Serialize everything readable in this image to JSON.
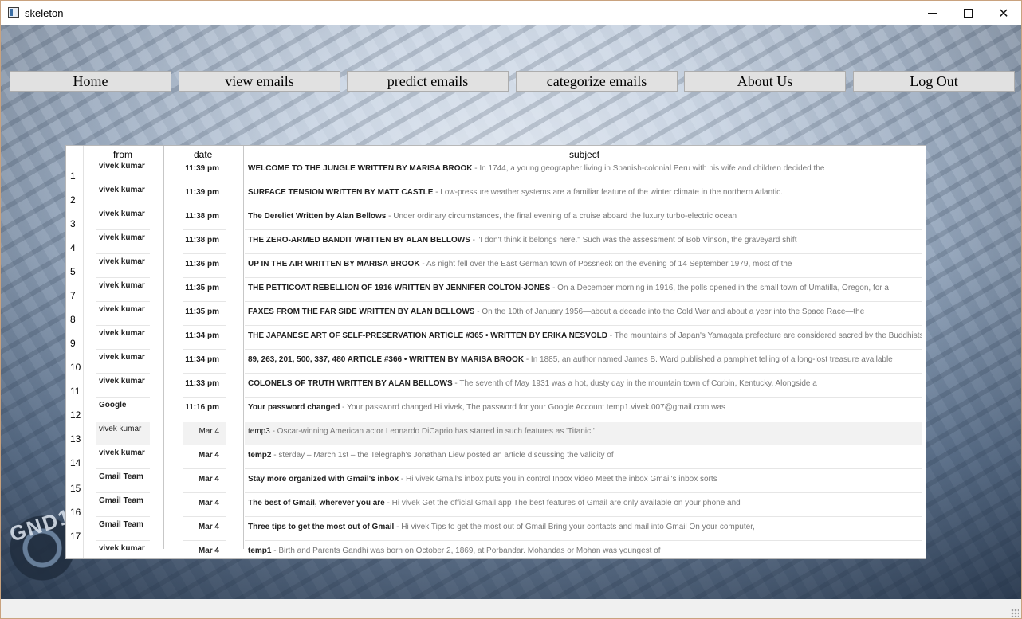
{
  "window": {
    "title": "skeleton"
  },
  "nav": [
    {
      "label": "Home"
    },
    {
      "label": "view emails"
    },
    {
      "label": "predict emails"
    },
    {
      "label": "categorize emails"
    },
    {
      "label": "About Us"
    },
    {
      "label": "Log Out"
    }
  ],
  "table": {
    "headers": {
      "from": "from",
      "date": "date",
      "subject": "subject"
    },
    "row_numbers": [
      "1",
      "2",
      "3",
      "4",
      "5",
      "7",
      "8",
      "9",
      "10",
      "11",
      "12",
      "13",
      "14",
      "15",
      "16",
      "17"
    ],
    "rows": [
      {
        "from": "vivek kumar",
        "date": "11:39 pm",
        "subject": "WELCOME TO THE JUNGLE WRITTEN BY MARISA BROOK",
        "snippet": " - In 1744, a young geographer living in Spanish-colonial Peru with his wife and children decided the",
        "read": false
      },
      {
        "from": "vivek kumar",
        "date": "11:39 pm",
        "subject": "SURFACE TENSION WRITTEN BY MATT CASTLE",
        "snippet": " - Low-pressure weather systems are a familiar feature of the winter climate in the northern Atlantic.",
        "read": false
      },
      {
        "from": "vivek kumar",
        "date": "11:38 pm",
        "subject": "The Derelict Written by Alan Bellows",
        "snippet": " - Under ordinary circumstances, the final evening of a cruise aboard the luxury turbo-electric ocean",
        "read": false
      },
      {
        "from": "vivek kumar",
        "date": "11:38 pm",
        "subject": "THE ZERO-ARMED BANDIT WRITTEN BY ALAN BELLOWS",
        "snippet": " - \"I don't think it belongs here.\" Such was the assessment of Bob Vinson, the graveyard shift",
        "read": false
      },
      {
        "from": "vivek kumar",
        "date": "11:36 pm",
        "subject": "UP IN THE AIR WRITTEN BY MARISA BROOK",
        "snippet": " - As night fell over the East German town of Pössneck on the evening of 14 September 1979, most of the",
        "read": false
      },
      {
        "from": "vivek kumar",
        "date": "11:35 pm",
        "subject": "THE PETTICOAT REBELLION OF 1916 WRITTEN BY JENNIFER COLTON-JONES",
        "snippet": " - On a December morning in 1916, the polls opened in the small town of Umatilla, Oregon, for a",
        "read": false
      },
      {
        "from": "vivek kumar",
        "date": "11:35 pm",
        "subject": "FAXES FROM THE FAR SIDE WRITTEN BY ALAN BELLOWS",
        "snippet": " - On the 10th of January 1956—about a decade into the Cold War and about a year into the Space Race—the",
        "read": false
      },
      {
        "from": "vivek kumar",
        "date": "11:34 pm",
        "subject": "THE JAPANESE ART OF SELF-PRESERVATION ARTICLE #365 • WRITTEN BY ERIKA NESVOLD",
        "snippet": " - The mountains of Japan's Yamagata prefecture are considered sacred by the Buddhists in the reg",
        "read": false
      },
      {
        "from": "vivek kumar",
        "date": "11:34 pm",
        "subject": "89, 263, 201, 500, 337, 480 ARTICLE #366 • WRITTEN BY MARISA BROOK",
        "snippet": " - In 1885, an author named James B. Ward published a pamphlet telling of a long-lost treasure available",
        "read": false
      },
      {
        "from": "vivek kumar",
        "date": "11:33 pm",
        "subject": "COLONELS OF TRUTH WRITTEN BY ALAN BELLOWS",
        "snippet": " - The seventh of May 1931 was a hot, dusty day in the mountain town of Corbin, Kentucky. Alongside a",
        "read": false
      },
      {
        "from": "Google",
        "date": "11:16 pm",
        "subject": "Your password changed",
        "snippet": " - Your password changed Hi vivek, The password for your Google Account temp1.vivek.007@gmail.com was",
        "read": false
      },
      {
        "from": "vivek kumar",
        "date": "Mar 4",
        "subject": "temp3",
        "snippet": " - Oscar-winning American actor Leonardo DiCaprio has starred in such features as 'Titanic,'",
        "read": true
      },
      {
        "from": "vivek kumar",
        "date": "Mar 4",
        "subject": "temp2",
        "snippet": " - sterday – March 1st – the Telegraph's Jonathan Liew posted an article discussing the validity of",
        "read": false
      },
      {
        "from": "Gmail Team",
        "date": "Mar 4",
        "subject": "Stay more organized with Gmail's inbox",
        "snippet": " - Hi vivek Gmail's inbox puts you in control Inbox video Meet the inbox Gmail's inbox sorts",
        "read": false
      },
      {
        "from": "Gmail Team",
        "date": "Mar 4",
        "subject": "The best of Gmail, wherever you are",
        "snippet": " - Hi vivek Get the official Gmail app The best features of Gmail are only available on your phone and",
        "read": false
      },
      {
        "from": "Gmail Team",
        "date": "Mar 4",
        "subject": "Three tips to get the most out of Gmail",
        "snippet": " - Hi vivek Tips to get the most out of Gmail Bring your contacts and mail into Gmail On your computer,",
        "read": false
      },
      {
        "from": "vivek kumar",
        "date": "Mar 4",
        "subject": "temp1",
        "snippet": " - Birth and Parents Gandhi was born on October 2, 1869, at Porbandar. Mohandas or Mohan was youngest of",
        "read": false
      }
    ]
  },
  "background": {
    "board_text": "GND1"
  }
}
